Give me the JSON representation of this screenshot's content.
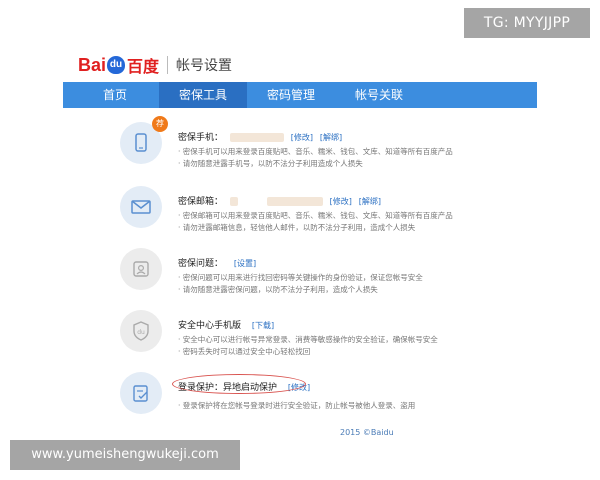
{
  "watermarks": {
    "top_right": "TG: MYYJJPP",
    "bottom_left": "www.yumeishengwukeji.com"
  },
  "header": {
    "logo_bai": "Bai",
    "logo_du": "du",
    "logo_cn": "百度",
    "title": "帐号设置"
  },
  "nav": {
    "tabs": [
      "首页",
      "密保工具",
      "密码管理",
      "帐号关联"
    ],
    "active_index": 1
  },
  "sections": [
    {
      "icon": "phone-icon",
      "badge": "荐",
      "title": "密保手机：",
      "links": [
        "[修改]",
        "[解绑]"
      ],
      "desc": [
        "· 密保手机可以用来登录百度贴吧、音乐、糯米、钱包、文库、知道等所有百度产品",
        "· 请勿随意泄露手机号，以防不法分子利用造成个人损失"
      ]
    },
    {
      "icon": "mail-icon",
      "title": "密保邮箱：",
      "links": [
        "[修改]",
        "[解绑]"
      ],
      "desc": [
        "· 密保邮箱可以用来登录百度贴吧、音乐、糯米、钱包、文库、知道等所有百度产品",
        "· 请勿泄露邮箱信息，轻信他人邮件，以防不法分子利用，造成个人损失"
      ]
    },
    {
      "icon": "question-icon",
      "title": "密保问题：",
      "links": [
        "[设置]"
      ],
      "desc": [
        "· 密保问题可以用来进行找回密码等关键操作的身份验证，保证您帐号安全",
        "· 请勿随意泄露密保问题，以防不法分子利用，造成个人损失"
      ]
    },
    {
      "icon": "shield-du-icon",
      "title": "安全中心手机版",
      "links": [
        "[下载]"
      ],
      "desc": [
        "· 安全中心可以进行帐号异常登录、消费等敏感操作的安全验证，确保帐号安全",
        "· 密码丢失时可以通过安全中心轻松找回"
      ]
    },
    {
      "icon": "login-protect-icon",
      "title": "登录保护：异地启动保护",
      "links": [
        "[修改]"
      ],
      "desc": [
        "· 登录保护将在您帐号登录时进行安全验证，防止帐号被他人登录、盗用"
      ]
    }
  ],
  "footer": "2015 ©Baidu",
  "colors": {
    "nav_bg": "#3c8ddf",
    "nav_active": "#2a6fc2",
    "link": "#2a6fc2",
    "badge": "#f07a1a",
    "highlight": "#d9534f"
  }
}
